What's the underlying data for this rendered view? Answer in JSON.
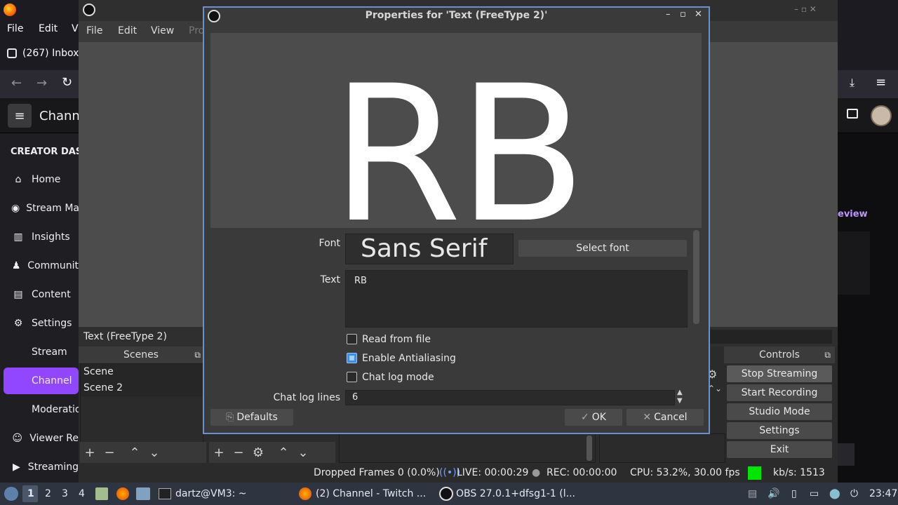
{
  "browser": {
    "menu": [
      "File",
      "Edit",
      "V"
    ],
    "tab_title": "(267) Inbox",
    "page_heading": "Chann",
    "side_heading": "CREATOR DASH",
    "side_items": [
      "Home",
      "Stream Ma",
      "Insights",
      "Communit",
      "Content",
      "Settings",
      "Stream",
      "Channel",
      "Moderatio",
      "Viewer Re",
      "Streaming"
    ],
    "active_item": "Channel",
    "right_link": "eview",
    "accent": "#9147ff"
  },
  "obs": {
    "menu": [
      "File",
      "Edit",
      "View",
      "Pro"
    ],
    "selected_source": "Text (FreeType 2)",
    "scenes_title": "Scenes",
    "scenes": [
      "Scene",
      "Scene 2"
    ],
    "controls_title": "Controls",
    "controls": [
      "Stop Streaming",
      "Start Recording",
      "Studio Mode",
      "Settings",
      "Exit"
    ],
    "status": {
      "dropped": "Dropped Frames 0 (0.0%)",
      "live": "LIVE: 00:00:29",
      "rec": "REC: 00:00:00",
      "cpu": "CPU: 53.2%, 30.00 fps",
      "kbps": "kb/s: 1513",
      "health_color": "#00e600"
    }
  },
  "dialog": {
    "title": "Properties for 'Text (FreeType 2)'",
    "preview_text": "RB",
    "font_label": "Font",
    "font_value": "Sans Serif",
    "select_font": "Select font",
    "text_label": "Text",
    "text_value": "RB",
    "read_from_file": "Read from file",
    "read_from_file_checked": false,
    "enable_antialiasing": "Enable Antialiasing",
    "enable_antialiasing_checked": true,
    "chat_log_mode": "Chat log mode",
    "chat_log_mode_checked": false,
    "chat_log_lines_label": "Chat log lines",
    "chat_log_lines_value": "6",
    "defaults": "Defaults",
    "ok": "OK",
    "cancel": "Cancel"
  },
  "taskbar": {
    "workspaces": [
      "1",
      "2",
      "3",
      "4"
    ],
    "tasks": [
      "dartz@VM3: ~",
      "(2) Channel - Twitch ...",
      "OBS 27.0.1+dfsg1-1 (l..."
    ],
    "clock": "23:47"
  }
}
